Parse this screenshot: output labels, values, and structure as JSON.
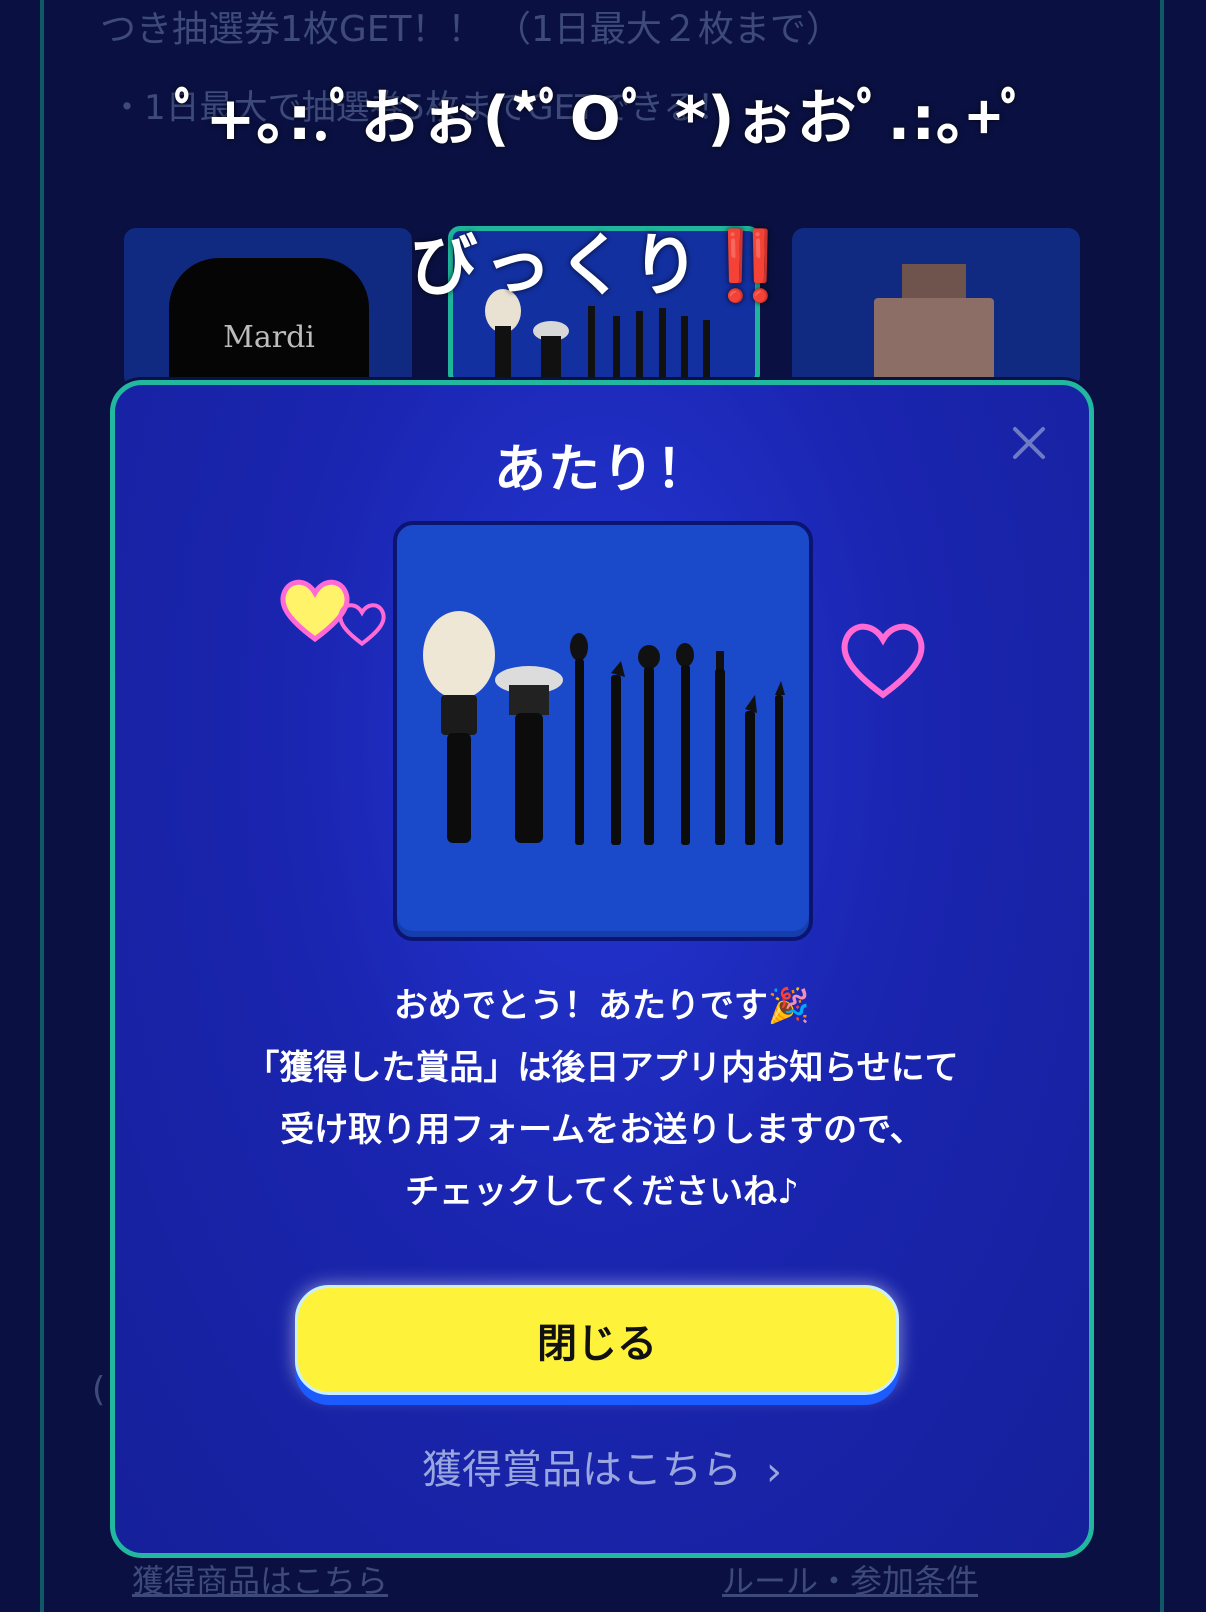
{
  "background": {
    "line1": "つき抽選券1枚GET！！ （1日最大２枚まで）",
    "line2": "・1日最大で抽選券5枚までGETできる！",
    "paren": "(",
    "prizes": [
      {
        "name": "sweatshirt",
        "brand": "Mardi"
      },
      {
        "name": "makeup-brush-set"
      },
      {
        "name": "perfume"
      }
    ],
    "bottom_links": {
      "left": "獲得商品はこちら",
      "right": "ルール・参加条件"
    }
  },
  "caption": {
    "line1": "ﾟ+｡:.ﾟおぉ(*ﾟOﾟ *)ぉおﾟ.:｡+ﾟ",
    "line2_text": "びっくり",
    "line2_emoji": "‼️"
  },
  "modal": {
    "title": "あたり！",
    "message": [
      "おめでとう！あたりです🎉",
      "「獲得した賞品」は後日アプリ内お知らせにて",
      "受け取り用フォームをお送りしますので、",
      "チェックしてくださいね♪"
    ],
    "close_button": "閉じる",
    "prizes_link": "獲得賞品はこちら",
    "prize_image_icon": "makeup-brush-set",
    "close_icon": "close-icon"
  },
  "colors": {
    "page_bg": "#0a1142",
    "modal_border": "#22b8a0",
    "modal_bg": "#1a25b0",
    "button_bg": "#fff23a",
    "button_shadow": "#1c5bff",
    "heart_pink": "#ff6ad5",
    "heart_yellow": "#fff36a"
  }
}
